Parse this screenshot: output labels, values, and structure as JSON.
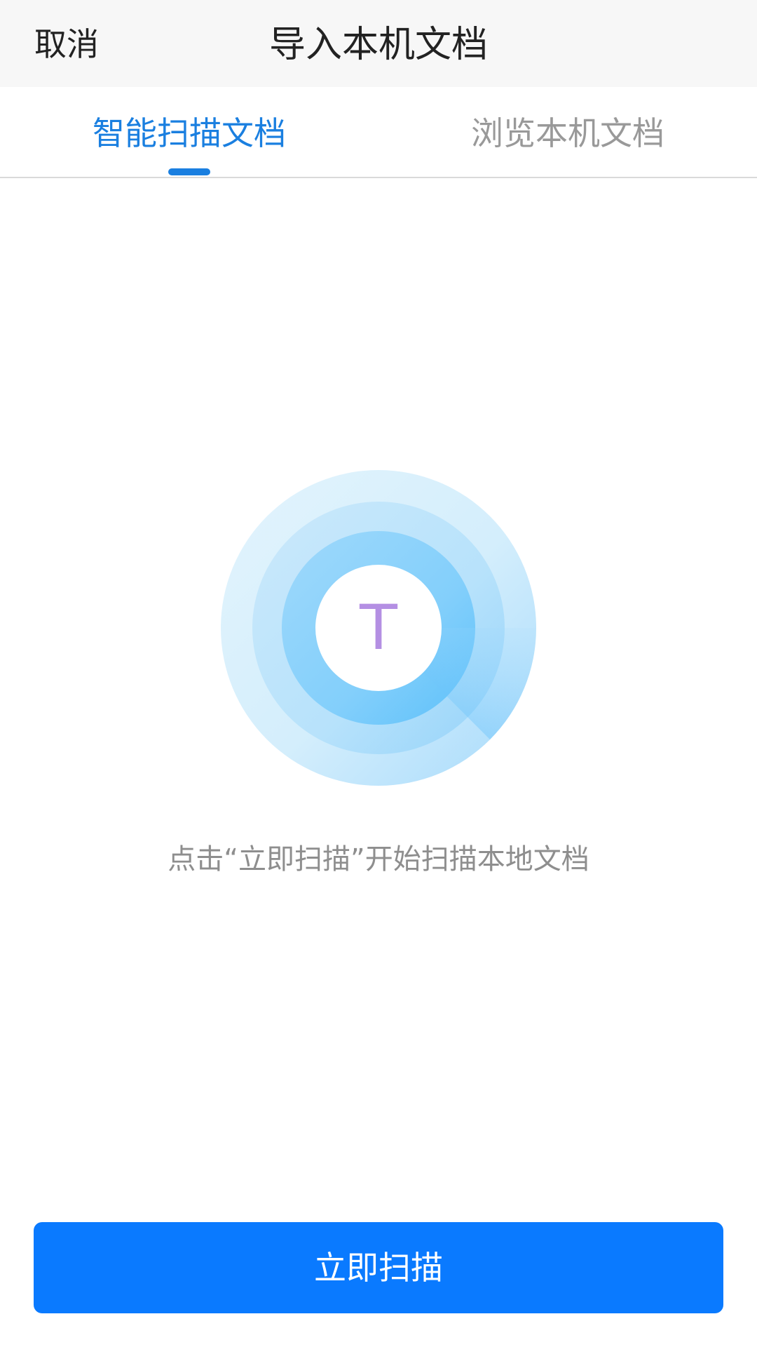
{
  "colors": {
    "accent": "#1a7fe0",
    "button": "#0a7aff",
    "header_bg": "#f7f7f7",
    "text_dark": "#222222",
    "text_muted": "#999999",
    "scan_letter": "#b48fe3"
  },
  "header": {
    "cancel_label": "取消",
    "title": "导入本机文档"
  },
  "tabs": [
    {
      "label": "智能扫描文档",
      "active": true
    },
    {
      "label": "浏览本机文档",
      "active": false
    }
  ],
  "scan": {
    "icon": "radar-scan-icon",
    "letter": "T"
  },
  "hint": "点击“立即扫描”开始扫描本地文档",
  "button": {
    "label": "立即扫描"
  }
}
